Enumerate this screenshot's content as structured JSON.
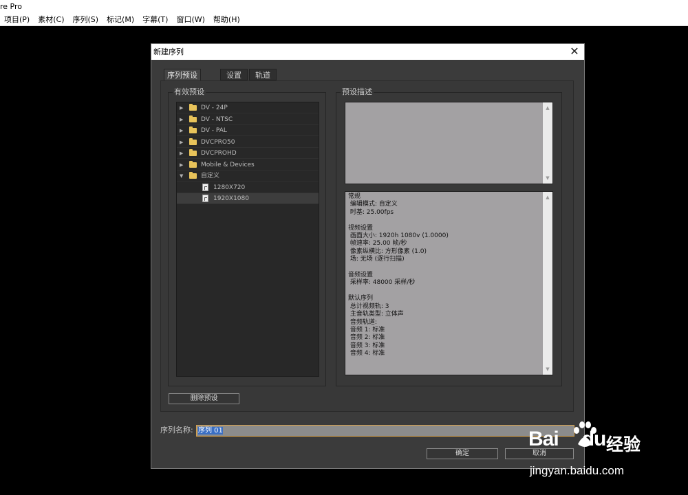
{
  "app": {
    "title": "re Pro"
  },
  "menu": [
    "项目(P)",
    "素材(C)",
    "序列(S)",
    "标记(M)",
    "字幕(T)",
    "窗口(W)",
    "帮助(H)"
  ],
  "dialog": {
    "title": "新建序列",
    "close_glyph": "✕",
    "tabs": [
      "序列预设",
      "设置",
      "轨道"
    ],
    "presets_group_label": "有效预设",
    "description_group_label": "预设描述",
    "tree": [
      {
        "label": "DV - 24P",
        "type": "folder",
        "expanded": false
      },
      {
        "label": "DV - NTSC",
        "type": "folder",
        "expanded": false
      },
      {
        "label": "DV - PAL",
        "type": "folder",
        "expanded": false
      },
      {
        "label": "DVCPRO50",
        "type": "folder",
        "expanded": false
      },
      {
        "label": "DVCPROHD",
        "type": "folder",
        "expanded": false
      },
      {
        "label": "Mobile & Devices",
        "type": "folder",
        "expanded": false
      },
      {
        "label": "自定义",
        "type": "folder",
        "expanded": true
      },
      {
        "label": "1280X720",
        "type": "preset"
      },
      {
        "label": "1920X1080",
        "type": "preset",
        "selected": true
      }
    ],
    "description_lines": [
      "常规",
      " 编辑模式: 自定义",
      " 时基: 25.00fps",
      "",
      "视频设置",
      " 画面大小: 1920h 1080v (1.0000)",
      " 帧速率: 25.00 帧/秒",
      " 像素纵横比: 方形像素 (1.0)",
      " 场: 无场 (逐行扫描)",
      "",
      "音频设置",
      " 采样率: 48000 采样/秒",
      "",
      "默认序列",
      " 总计视频轨: 3",
      " 主音轨类型: 立体声",
      " 音频轨道:",
      " 音频 1: 标准",
      " 音频 2: 标准",
      " 音频 3: 标准",
      " 音频 4: 标准"
    ],
    "delete_preset_label": "删除预设",
    "sequence_name_label": "序列名称:",
    "sequence_name_value": "序列 01",
    "ok_label": "确定",
    "cancel_label": "取消"
  },
  "watermark": {
    "logo": "Bai",
    "logo_suffix": "du",
    "cn": "经验",
    "url": "jingyan.baidu.com"
  }
}
